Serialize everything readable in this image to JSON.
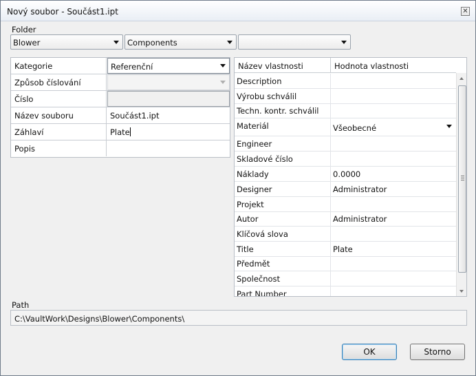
{
  "window": {
    "title": "Nový soubor - Součást1.ipt"
  },
  "folder": {
    "label": "Folder",
    "combo1": "Blower",
    "combo2": "Components",
    "combo3": ""
  },
  "left_grid": {
    "rows": [
      {
        "key": "Kategorie",
        "value": "Referenční"
      },
      {
        "key": "Způsob číslování",
        "value": ""
      },
      {
        "key": "Číslo",
        "value": ""
      },
      {
        "key": "Název souboru",
        "value": "Součást1.ipt"
      },
      {
        "key": "Záhlaví",
        "value": "Plate"
      },
      {
        "key": "Popis",
        "value": ""
      }
    ]
  },
  "right_grid": {
    "col1": "Název vlastnosti",
    "col2": "Hodnota vlastnosti",
    "rows": [
      {
        "key": "Description",
        "value": ""
      },
      {
        "key": "Výrobu schválil",
        "value": ""
      },
      {
        "key": "Techn. kontr. schválil",
        "value": ""
      },
      {
        "key": "Materiál",
        "value": "Všeobecné"
      },
      {
        "key": "Engineer",
        "value": ""
      },
      {
        "key": "Skladové číslo",
        "value": ""
      },
      {
        "key": "Náklady",
        "value": "0.0000"
      },
      {
        "key": "Designer",
        "value": "Administrator"
      },
      {
        "key": "Projekt",
        "value": ""
      },
      {
        "key": "Autor",
        "value": "Administrator"
      },
      {
        "key": "Klíčová slova",
        "value": ""
      },
      {
        "key": "Title",
        "value": "Plate"
      },
      {
        "key": "Předmět",
        "value": ""
      },
      {
        "key": "Společnost",
        "value": ""
      },
      {
        "key": "Part Number",
        "value": ""
      }
    ]
  },
  "path": {
    "label": "Path",
    "value": "C:\\VaultWork\\Designs\\Blower\\Components\\"
  },
  "buttons": {
    "ok": "OK",
    "cancel": "Storno"
  }
}
